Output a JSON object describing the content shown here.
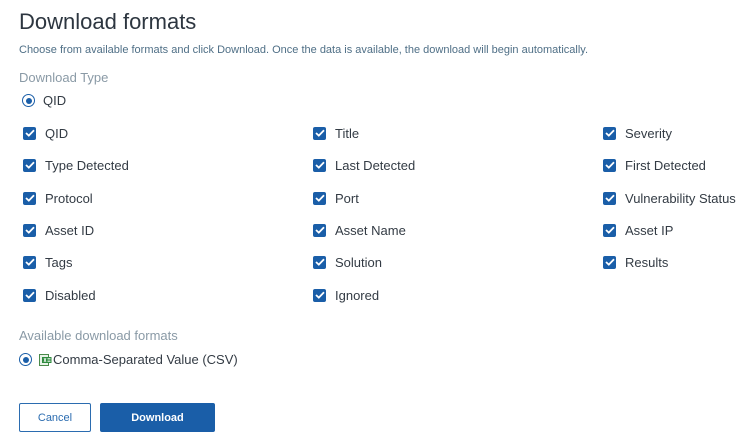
{
  "dialog": {
    "title": "Download formats",
    "description": "Choose from available formats and click Download. Once the data is available, the download will begin automatically."
  },
  "download_type": {
    "label": "Download Type",
    "selected_option": "QID"
  },
  "fields": {
    "col1": [
      {
        "label": "QID",
        "checked": true
      },
      {
        "label": "Type Detected",
        "checked": true
      },
      {
        "label": "Protocol",
        "checked": true
      },
      {
        "label": "Asset ID",
        "checked": true
      },
      {
        "label": "Tags",
        "checked": true
      },
      {
        "label": "Disabled",
        "checked": true
      }
    ],
    "col2": [
      {
        "label": "Title",
        "checked": true
      },
      {
        "label": "Last Detected",
        "checked": true
      },
      {
        "label": "Port",
        "checked": true
      },
      {
        "label": "Asset Name",
        "checked": true
      },
      {
        "label": "Solution",
        "checked": true
      },
      {
        "label": "Ignored",
        "checked": true
      }
    ],
    "col3": [
      {
        "label": "Severity",
        "checked": true
      },
      {
        "label": "First Detected",
        "checked": true
      },
      {
        "label": "Vulnerability Status",
        "checked": true
      },
      {
        "label": "Asset IP",
        "checked": true
      },
      {
        "label": "Results",
        "checked": true
      }
    ]
  },
  "formats": {
    "label": "Available download formats",
    "options": [
      {
        "label": "Comma-Separated Value (CSV)",
        "icon": "csv-file-icon",
        "selected": true
      }
    ]
  },
  "buttons": {
    "cancel": "Cancel",
    "download": "Download"
  },
  "colors": {
    "accent": "#1a5ea8",
    "title": "#2d3640",
    "muted": "#8a9aa6"
  }
}
